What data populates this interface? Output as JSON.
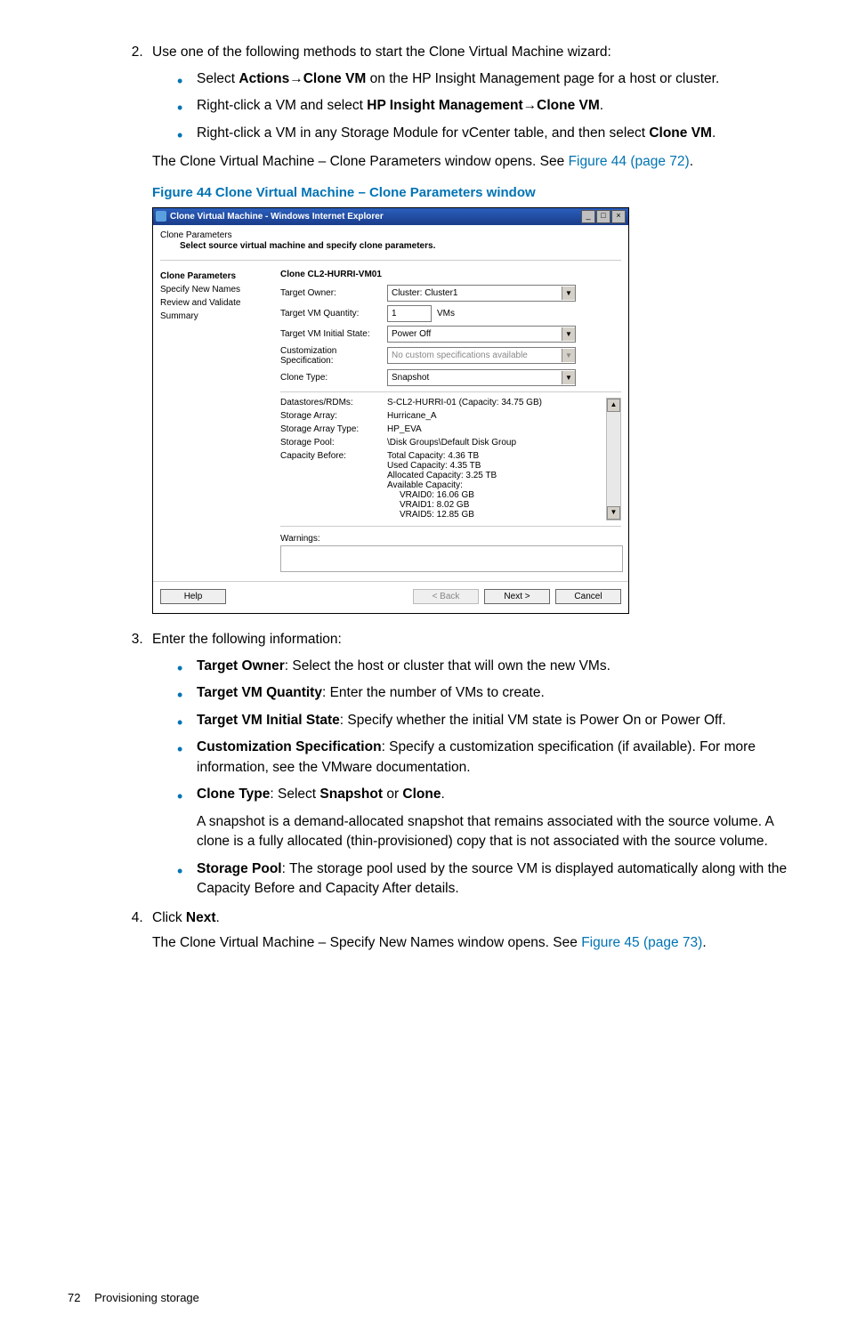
{
  "step2": {
    "intro": "Use one of the following methods to start the Clone Virtual Machine wizard:",
    "b1_pre": "Select ",
    "b1_bold1": "Actions",
    "b1_arrow": "→",
    "b1_bold2": "Clone VM",
    "b1_post": " on the HP Insight Management page for a host or cluster.",
    "b2_pre": "Right-click a VM and select ",
    "b2_bold1": "HP Insight Management",
    "b2_arrow": "→",
    "b2_bold2": "Clone VM",
    "b2_post": ".",
    "b3_pre": "Right-click a VM in any Storage Module for vCenter table, and then select ",
    "b3_bold": "Clone VM",
    "b3_post": ".",
    "after1": "The Clone Virtual Machine – Clone Parameters window opens. See ",
    "after1_link": "Figure 44 (page 72)",
    "after1_end": "."
  },
  "figcap": "Figure 44 Clone Virtual Machine – Clone Parameters window",
  "dlg": {
    "title": "Clone Virtual Machine - Windows Internet Explorer",
    "hdr": "Clone Parameters",
    "sub": "Select source virtual machine and specify clone parameters.",
    "side": {
      "s1": "Clone Parameters",
      "s2": "Specify New Names",
      "s3": "Review and Validate",
      "s4": "Summary"
    },
    "mainhdr": "Clone CL2-HURRI-VM01",
    "rows": {
      "r1l": "Target Owner:",
      "r1v": "Cluster: Cluster1",
      "r2l": "Target VM Quantity:",
      "r2v": "1",
      "r2suf": "VMs",
      "r3l": "Target VM Initial State:",
      "r3v": "Power Off",
      "r4l": "Customization Specification:",
      "r4v": "No custom specifications available",
      "r5l": "Clone Type:",
      "r5v": "Snapshot",
      "r6l": "Datastores/RDMs:",
      "r6v": "S-CL2-HURRI-01 (Capacity: 34.75 GB)",
      "r7l": "Storage Array:",
      "r7v": "Hurricane_A",
      "r8l": "Storage Array Type:",
      "r8v": "HP_EVA",
      "r9l": "Storage Pool:",
      "r9v": "\\Disk Groups\\Default Disk Group",
      "r10l": "Capacity Before:",
      "r10a": "Total Capacity: 4.36 TB",
      "r10b": "Used Capacity: 4.35 TB",
      "r10c": "Allocated Capacity: 3.25 TB",
      "r10d": "Available Capacity:",
      "r10e": "VRAID0: 16.06 GB",
      "r10f": "VRAID1: 8.02 GB",
      "r10g": "VRAID5: 12.85 GB",
      "warn": "Warnings:"
    },
    "foot": {
      "help": "Help",
      "back": "< Back",
      "next": "Next >",
      "cancel": "Cancel"
    }
  },
  "step3": {
    "intro": "Enter the following information:",
    "b1b": "Target Owner",
    "b1t": ": Select the host or cluster that will own the new VMs.",
    "b2b": "Target VM Quantity",
    "b2t": ": Enter the number of VMs to create.",
    "b3b": "Target VM Initial State",
    "b3t": ": Specify whether the initial VM state is Power On or Power Off.",
    "b4b": "Customization Specification",
    "b4t": ": Specify a customization specification (if available). For more information, see the VMware documentation.",
    "b5b": "Clone Type",
    "b5t1": ": Select ",
    "b5t2": "Snapshot",
    "b5t3": " or ",
    "b5t4": "Clone",
    "b5t5": ".",
    "b5para": "A snapshot is a demand-allocated snapshot that remains associated with the source volume. A clone is a fully allocated (thin-provisioned) copy that is not associated with the source volume.",
    "b6b": "Storage Pool",
    "b6t": ": The storage pool used by the source VM is displayed automatically along with the Capacity Before and Capacity After details."
  },
  "step4": {
    "t1": "Click ",
    "b": "Next",
    "t2": ".",
    "after": "The Clone Virtual Machine – Specify New Names window opens. See ",
    "link": "Figure 45 (page 73)",
    "end": "."
  },
  "footer": {
    "page": "72",
    "section": "Provisioning storage"
  }
}
